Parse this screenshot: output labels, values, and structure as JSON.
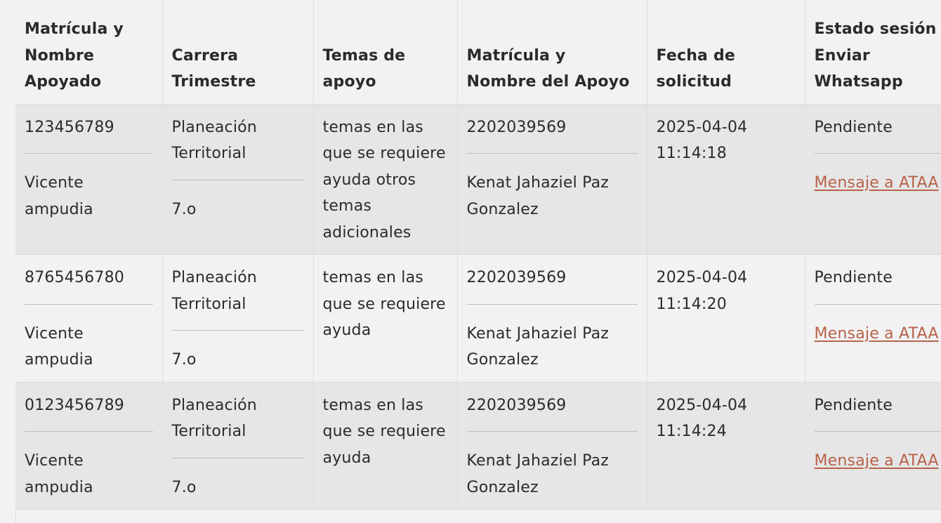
{
  "table": {
    "headers": [
      [
        "Matrícula y",
        "Nombre",
        "Apoyado"
      ],
      [
        "Carrera",
        "Trimestre"
      ],
      [
        "Temas de",
        "apoyo"
      ],
      [
        "Matrícula y",
        "Nombre del Apoyo"
      ],
      [
        "Fecha de",
        "solicitud"
      ],
      [
        "Estado sesión",
        "Enviar",
        "Whatsapp"
      ]
    ],
    "rows": [
      {
        "matricula": "123456789",
        "nombre": "Vicente ampudia",
        "carrera": "Planeación Territorial",
        "trimestre": "7.o",
        "temas": "temas en las que se requiere ayuda otros temas adicionales",
        "apoyo_matricula": "2202039569",
        "apoyo_nombre": "Kenat Jahaziel Paz Gonzalez",
        "fecha": "2025-04-04 11:14:18",
        "estado": "Pendiente",
        "whatsapp_link": "Mensaje a ATAA"
      },
      {
        "matricula": "8765456780",
        "nombre": "Vicente ampudia",
        "carrera": "Planeación Territorial",
        "trimestre": "7.o",
        "temas": "temas en las que se requiere ayuda",
        "apoyo_matricula": "2202039569",
        "apoyo_nombre": "Kenat Jahaziel Paz Gonzalez",
        "fecha": "2025-04-04 11:14:20",
        "estado": "Pendiente",
        "whatsapp_link": "Mensaje a ATAA"
      },
      {
        "matricula": "0123456789",
        "nombre": "Vicente ampudia",
        "carrera": "Planeación Territorial",
        "trimestre": "7.o",
        "temas": "temas en las que se requiere ayuda",
        "apoyo_matricula": "2202039569",
        "apoyo_nombre": "Kenat Jahaziel Paz Gonzalez",
        "fecha": "2025-04-04 11:14:24",
        "estado": "Pendiente",
        "whatsapp_link": "Mensaje a ATAA"
      }
    ]
  },
  "colors": {
    "row_shaded": "#e6e6e6",
    "row_plain": "#f2f2f2",
    "link": "#b8624a",
    "text": "#2b2b2b"
  }
}
